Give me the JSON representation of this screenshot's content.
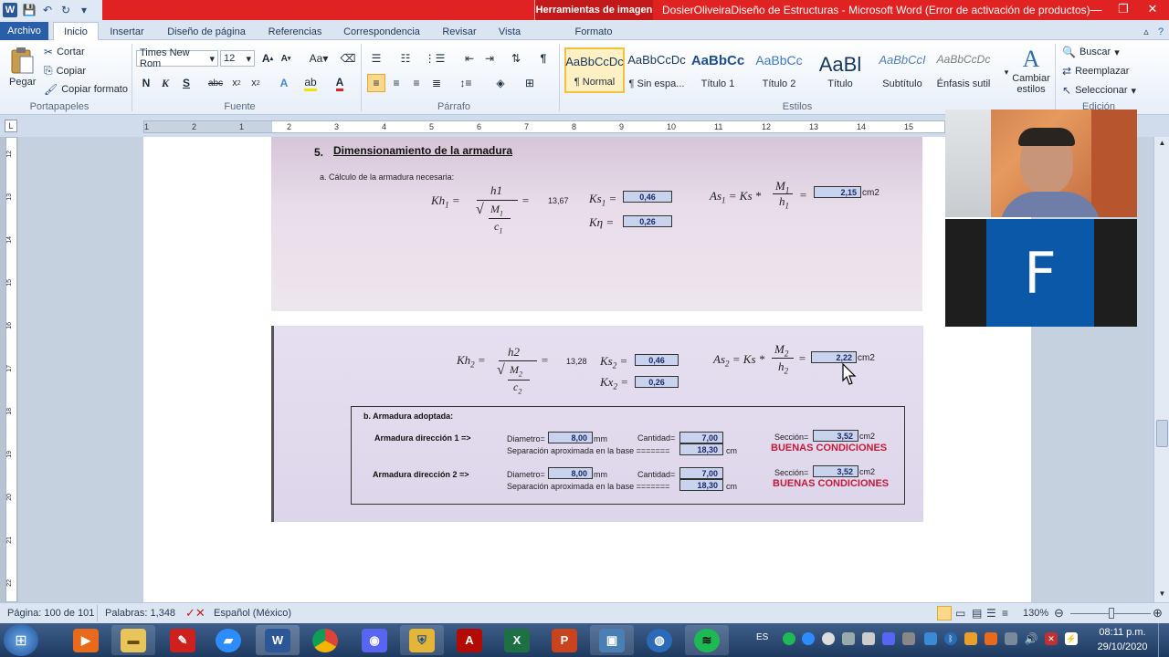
{
  "titlebar": {
    "app_icon": "W",
    "context_tab": "Herramientas de imagen",
    "title": "DosierOliveiraDiseño de Estructuras  -  Microsoft Word (Error de activación de productos)"
  },
  "tabs": {
    "archivo": "Archivo",
    "items": [
      "Inicio",
      "Insertar",
      "Diseño de página",
      "Referencias",
      "Correspondencia",
      "Revisar",
      "Vista"
    ],
    "formato": "Formato"
  },
  "ribbon": {
    "clipboard": {
      "paste": "Pegar",
      "cut": "Cortar",
      "copy": "Copiar",
      "format_painter": "Copiar formato",
      "group": "Portapapeles"
    },
    "font": {
      "family": "Times New Rom",
      "size": "12",
      "group": "Fuente"
    },
    "paragraph": {
      "group": "Párrafo"
    },
    "styles": {
      "group": "Estilos",
      "items": [
        {
          "preview": "AaBbCcDc",
          "name": "¶ Normal"
        },
        {
          "preview": "AaBbCcDc",
          "name": "¶ Sin espa..."
        },
        {
          "preview": "AaBbCc",
          "name": "Título 1"
        },
        {
          "preview": "AaBbCc",
          "name": "Título 2"
        },
        {
          "preview": "AaBl",
          "name": "Título"
        },
        {
          "preview": "AaBbCcI",
          "name": "Subtítulo"
        },
        {
          "preview": "AaBbCcDc",
          "name": "Énfasis sutil"
        }
      ],
      "change_styles": "Cambiar estilos"
    },
    "editing": {
      "find": "Buscar",
      "replace": "Reemplazar",
      "select": "Seleccionar",
      "group": "Edición"
    }
  },
  "ruler": {
    "marks": [
      "1",
      "2",
      "1",
      "2",
      "3",
      "4",
      "5",
      "6",
      "7",
      "8",
      "9",
      "10",
      "11",
      "12",
      "13",
      "14",
      "15",
      "16"
    ]
  },
  "vruler": {
    "marks": [
      "12",
      "13",
      "14",
      "15",
      "16",
      "17",
      "18",
      "19",
      "20",
      "21",
      "22"
    ]
  },
  "scan1": {
    "heading_num": "5.",
    "heading": "Dimensionamiento de la armadura",
    "sub": "a.  Cálculo de la armadura necesaria:",
    "kh_label": "Kh",
    "kh_sub": "1",
    "kh_num": "h1",
    "kh_den_m": "M",
    "kh_den_msub": "1",
    "kh_den_c": "c",
    "kh_den_csub": "1",
    "kh_value": "13,67",
    "ks_label": "Ks",
    "ks_sub": "1",
    "ks_value": "0,46",
    "kx_label": "Kη",
    "kx_value": "0,26",
    "as_label": "As",
    "as_sub": "1",
    "as_formula": "= Ks *",
    "as_num": "M",
    "as_numsub": "1",
    "as_den": "h",
    "as_densub": "1",
    "as_value": "2,15",
    "as_unit": "cm2"
  },
  "scan2": {
    "kh_label": "Kh",
    "kh_sub": "2",
    "kh_num": "h2",
    "kh_den_m": "M",
    "kh_den_msub": "2",
    "kh_den_c": "c",
    "kh_den_csub": "2",
    "kh_value": "13,28",
    "ks_label": "Ks",
    "ks_sub": "2",
    "ks_value": "0,46",
    "kx_label": "Kx",
    "kx_sub": "2",
    "kx_value": "0,26",
    "as_label": "As",
    "as_sub": "2",
    "as_formula": "= Ks *",
    "as_num": "M",
    "as_numsub": "2",
    "as_den": "h",
    "as_densub": "2",
    "as_value": "2,22",
    "as_unit": "cm2",
    "adopted_title": "b.  Armadura adoptada:",
    "rows": [
      {
        "label": "Armadura dirección 1 =>",
        "diam_label": "Diametro=",
        "diam": "8,00",
        "diam_unit": "mm",
        "qty_label": "Cantidad=",
        "qty": "7,00",
        "sep_label": "Separación aproximada en la base =======",
        "sep": "18,30",
        "sep_unit": "cm",
        "sec_label": "Sección=",
        "sec": "3,52",
        "sec_unit": "cm2",
        "status": "BUENAS CONDICIONES"
      },
      {
        "label": "Armadura dirección 2 =>",
        "diam_label": "Diametro=",
        "diam": "8,00",
        "diam_unit": "mm",
        "qty_label": "Cantidad=",
        "qty": "7,00",
        "sep_label": "Separación aproximada en la base =======",
        "sep": "18,30",
        "sep_unit": "cm",
        "sec_label": "Sección=",
        "sec": "3,52",
        "sec_unit": "cm2",
        "status": "BUENAS CONDICIONES"
      }
    ]
  },
  "video": {
    "initial": "F"
  },
  "status": {
    "page": "Página: 100 de 101",
    "words": "Palabras: 1,348",
    "language": "Español (México)",
    "zoom": "130%"
  },
  "taskbar": {
    "time": "08:11 p.m.",
    "date": "29/10/2020",
    "lang": "ES"
  }
}
